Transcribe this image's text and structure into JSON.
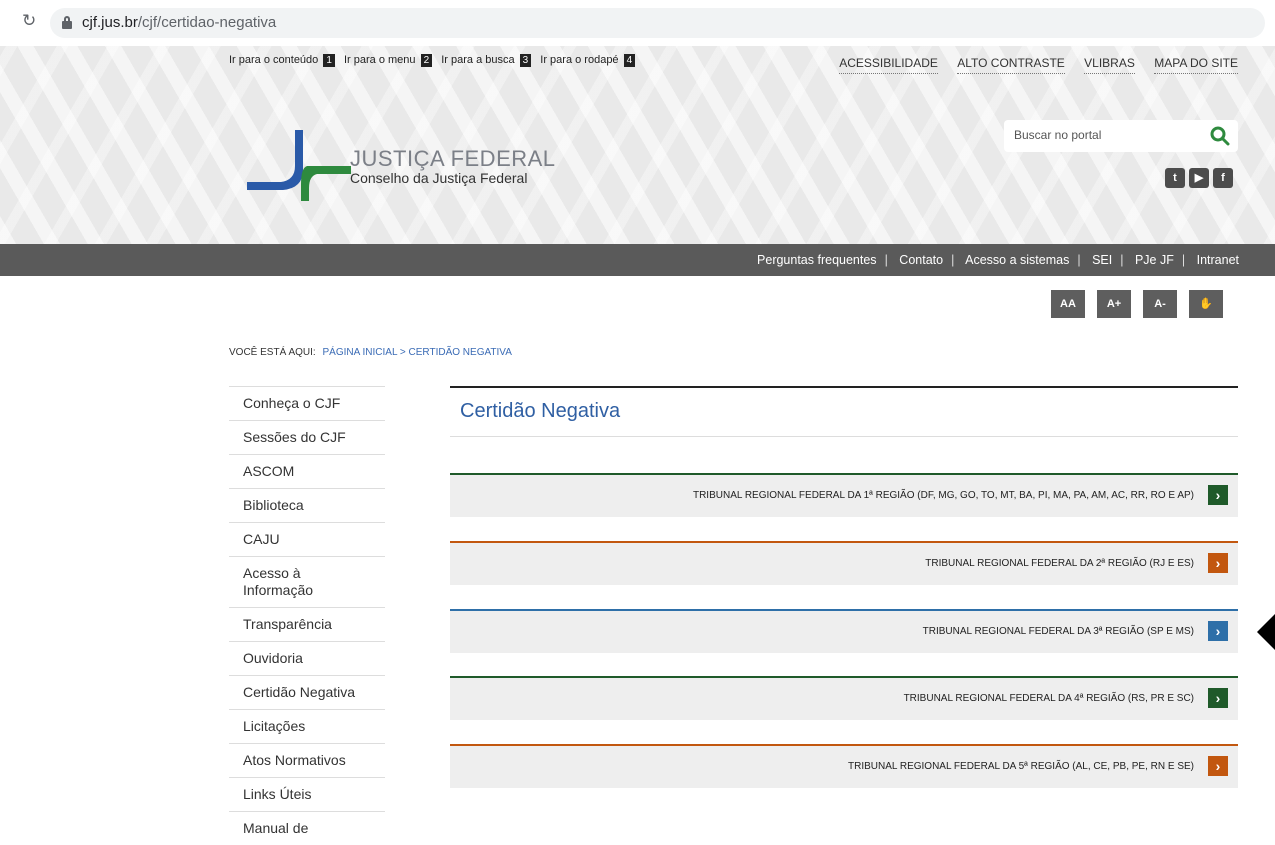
{
  "browser": {
    "url_domain": "cjf.jus.br",
    "url_path": "/cjf/certidao-negativa"
  },
  "skip_links": [
    {
      "label": "Ir para o conteúdo",
      "num": "1"
    },
    {
      "label": "Ir para o menu",
      "num": "2"
    },
    {
      "label": "Ir para a busca",
      "num": "3"
    },
    {
      "label": "Ir para o rodapé",
      "num": "4"
    }
  ],
  "top_links": [
    "ACESSIBILIDADE",
    "ALTO CONTRASTE",
    "VLIBRAS",
    "MAPA DO SITE"
  ],
  "logo": {
    "title": "JUSTIÇA FEDERAL",
    "subtitle": "Conselho da Justiça Federal"
  },
  "search": {
    "placeholder": "Buscar no portal"
  },
  "social": [
    "twitter-icon",
    "youtube-icon",
    "facebook-icon"
  ],
  "nav": [
    "Perguntas frequentes",
    "Contato",
    "Acesso a sistemas",
    "SEI",
    "PJe JF",
    "Intranet"
  ],
  "accessibility": [
    "AA",
    "A+",
    "A-"
  ],
  "breadcrumb": {
    "prefix": "VOCÊ ESTÁ AQUI:",
    "path": "PÁGINA INICIAL > CERTIDÃO NEGATIVA"
  },
  "sidebar": [
    "Conheça o CJF",
    "Sessões do CJF",
    "ASCOM",
    "Biblioteca",
    "CAJU",
    "Acesso à Informação",
    "Transparência",
    "Ouvidoria",
    "Certidão Negativa",
    "Licitações",
    "Atos Normativos",
    "Links Úteis",
    "Manual de"
  ],
  "main": {
    "title": "Certidão Negativa",
    "regions": [
      {
        "label": "TRIBUNAL REGIONAL FEDERAL DA 1ª REGIÃO (DF, MG, GO, TO, MT, BA, PI, MA, PA, AM, AC, RR, RO E AP)",
        "color": "#1f5a2a"
      },
      {
        "label": "TRIBUNAL REGIONAL FEDERAL DA 2ª REGIÃO (RJ E ES)",
        "color": "#c2570f"
      },
      {
        "label": "TRIBUNAL REGIONAL FEDERAL DA 3ª REGIÃO (SP E MS)",
        "color": "#2e6fa8"
      },
      {
        "label": "TRIBUNAL REGIONAL FEDERAL DA 4ª REGIÃO (RS, PR E SC)",
        "color": "#1f5a2a"
      },
      {
        "label": "TRIBUNAL REGIONAL FEDERAL DA 5ª REGIÃO (AL, CE, PB, PE, RN E SE)",
        "color": "#c2570f"
      }
    ]
  }
}
